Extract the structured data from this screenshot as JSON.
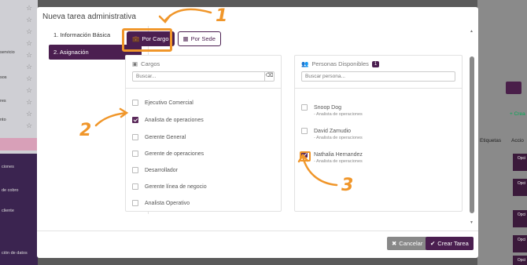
{
  "background": {
    "left_labels": [
      "servicio",
      "sos",
      "res",
      "nto"
    ],
    "left_dark_labels": [
      "ciones",
      "de cobro",
      "cliente",
      "ción de datos"
    ],
    "right_labels": [
      "+ Crea",
      "Etiquetas",
      "Accio"
    ],
    "opciones_label": "Opci"
  },
  "modal": {
    "title": "Nueva tarea administrativa",
    "steps": [
      {
        "label": "1. Información Básica",
        "active": false
      },
      {
        "label": "2. Asignación",
        "active": true
      }
    ],
    "tabs": [
      {
        "label": "Por Cargo",
        "icon": "briefcase-icon",
        "active": true
      },
      {
        "label": "Por Sede",
        "icon": "building-icon",
        "active": false
      }
    ],
    "cargos": {
      "title": "Cargos",
      "search_placeholder": "Buscar...",
      "items": [
        {
          "label": "Ejecutivo Comercial",
          "checked": false
        },
        {
          "label": "Analista de operaciones",
          "checked": true
        },
        {
          "label": "Gerente General",
          "checked": false
        },
        {
          "label": "Gerente de operaciones",
          "checked": false
        },
        {
          "label": "Desarrollador",
          "checked": false
        },
        {
          "label": "Gerente línea de negocio",
          "checked": false
        },
        {
          "label": "Analista Operativo",
          "checked": false
        }
      ]
    },
    "personas": {
      "title": "Personas Disponibles",
      "count": "1",
      "search_placeholder": "Buscar persona...",
      "items": [
        {
          "name": "Snoop Dog",
          "role": "- Analista de operaciones",
          "checked": false
        },
        {
          "name": "David Zamudio",
          "role": "- Analista de operaciones",
          "checked": false
        },
        {
          "name": "Nathalia Hernandez",
          "role": "- Analista de operaciones",
          "checked": true
        }
      ]
    },
    "buttons": {
      "cancel": "Cancelar",
      "create": "Crear Tarea"
    }
  },
  "annotations": [
    "1",
    "2",
    "3"
  ],
  "colors": {
    "primary": "#4b1f50",
    "annotation": "#f0962a"
  }
}
